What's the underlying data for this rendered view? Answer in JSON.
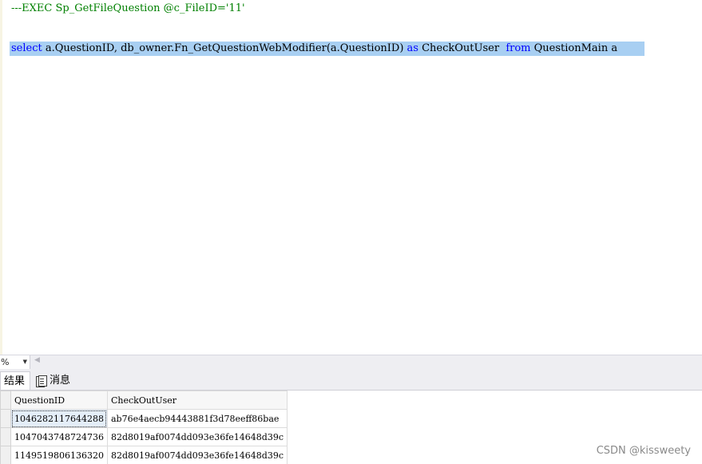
{
  "editor": {
    "line1": {
      "comment": "---EXEC Sp_GetFileQuestion @c_FileID='11'"
    },
    "line2": {
      "kw_select": "select",
      "part1": " a.QuestionID, db_owner.Fn_GetQuestionWebModifier(a.QuestionID) ",
      "kw_as": "as",
      "part2": " CheckOutUser  ",
      "kw_from": "from",
      "part3": " QuestionMain a"
    }
  },
  "zoom": {
    "value": "%"
  },
  "tabs": [
    {
      "label": "结果"
    },
    {
      "label": "消息"
    }
  ],
  "grid": {
    "columns": [
      "QuestionID",
      "CheckOutUser"
    ],
    "rows": [
      [
        "1046282117644288",
        "ab76e4aecb94443881f3d78eeff86bae"
      ],
      [
        "1047043748724736",
        "82d8019af0074dd093e36fe14648d39c"
      ],
      [
        "1149519806136320",
        "82d8019af0074dd093e36fe14648d39c"
      ]
    ]
  },
  "watermark": "CSDN @kissweety",
  "colors": {
    "selection": "#a8cff2",
    "keyword": "#0000ff",
    "comment": "#008000"
  }
}
